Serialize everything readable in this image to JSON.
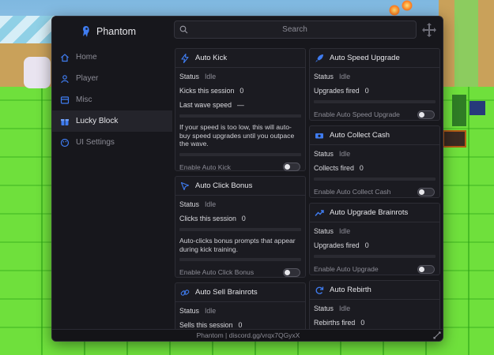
{
  "colors": {
    "accent": "#3f7cf0",
    "panel": "#17171c",
    "card": "#1b1b21",
    "grass": "#6fe03c"
  },
  "app": {
    "name": "Phantom",
    "footer": "Phantom | discord.gg/vrqx7QGyxX"
  },
  "search": {
    "placeholder": "Search"
  },
  "sidebar": {
    "items": [
      {
        "label": "Home",
        "icon": "home-icon"
      },
      {
        "label": "Player",
        "icon": "user-icon"
      },
      {
        "label": "Misc",
        "icon": "layers-icon"
      },
      {
        "label": "Lucky Block",
        "icon": "gift-icon",
        "active": true
      },
      {
        "label": "UI Settings",
        "icon": "palette-icon"
      }
    ]
  },
  "cards": {
    "auto_kick": {
      "title": "Auto Kick",
      "icon": "lightning-icon",
      "status_label": "Status",
      "status_value": "Idle",
      "count_label": "Kicks this session",
      "count_value": "0",
      "speed_label": "Last wave speed",
      "speed_value": "—",
      "description": "If your speed is too low, this will auto-buy speed upgrades until you outpace the wave.",
      "toggle_label": "Enable Auto Kick"
    },
    "auto_click_bonus": {
      "title": "Auto Click Bonus",
      "icon": "cursor-icon",
      "status_label": "Status",
      "status_value": "Idle",
      "count_label": "Clicks this session",
      "count_value": "0",
      "description": "Auto-clicks bonus prompts that appear during kick training.",
      "toggle_label": "Enable Auto Click Bonus"
    },
    "auto_sell_brainrots": {
      "title": "Auto Sell Brainrots",
      "icon": "link-icon",
      "status_label": "Status",
      "status_value": "Idle",
      "count_label": "Sells this session",
      "count_value": "0"
    },
    "auto_speed_upgrade": {
      "title": "Auto Speed Upgrade",
      "icon": "rocket-icon",
      "status_label": "Status",
      "status_value": "Idle",
      "count_label": "Upgrades fired",
      "count_value": "0",
      "toggle_label": "Enable Auto Speed Upgrade"
    },
    "auto_collect_cash": {
      "title": "Auto Collect Cash",
      "icon": "cash-icon",
      "status_label": "Status",
      "status_value": "Idle",
      "count_label": "Collects fired",
      "count_value": "0",
      "toggle_label": "Enable Auto Collect Cash"
    },
    "auto_upgrade_brainrots": {
      "title": "Auto Upgrade Brainrots",
      "icon": "trend-up-icon",
      "status_label": "Status",
      "status_value": "Idle",
      "count_label": "Upgrades fired",
      "count_value": "0",
      "toggle_label": "Enable Auto Upgrade"
    },
    "auto_rebirth": {
      "title": "Auto Rebirth",
      "icon": "refresh-icon",
      "status_label": "Status",
      "status_value": "Idle",
      "count_label": "Rebirths fired",
      "count_value": "0"
    }
  }
}
